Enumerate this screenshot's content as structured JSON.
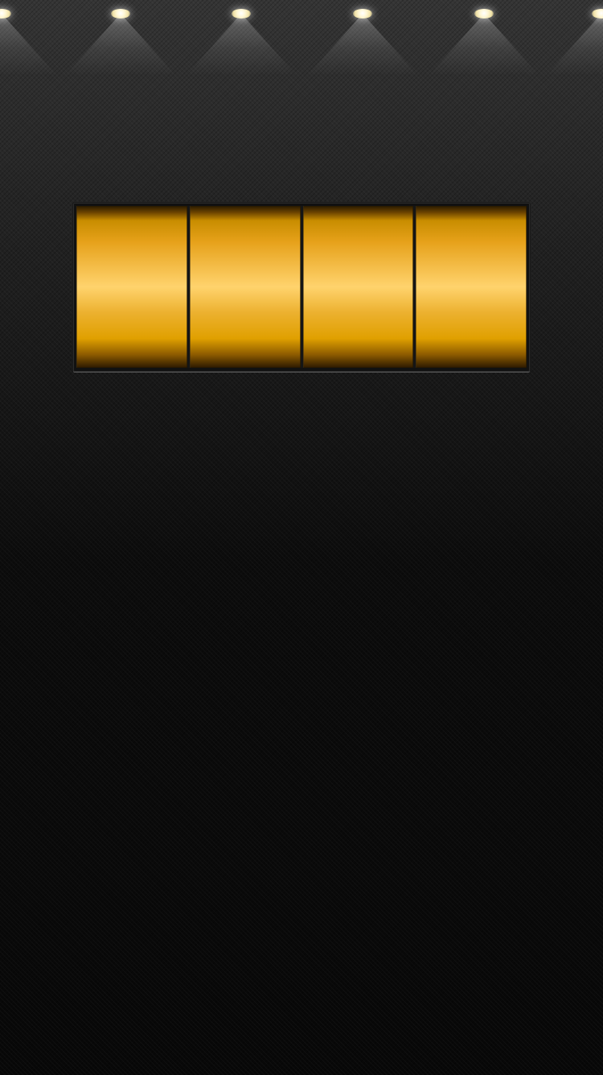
{
  "scene": {
    "background_color": "#0a0a0a",
    "accent_gold": "#e6a11a"
  },
  "lights": {
    "count": 6,
    "icon": "spotlight-icon"
  },
  "slot_machine": {
    "reel_count": 4
  }
}
